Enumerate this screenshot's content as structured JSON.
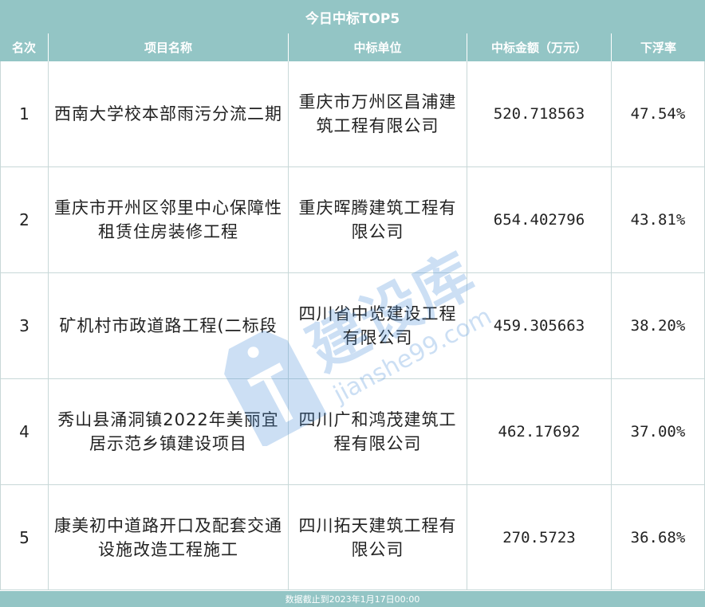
{
  "title": "今日中标TOP5",
  "headers": {
    "rank": "名次",
    "project": "项目名称",
    "winner": "中标单位",
    "amount": "中标金额（万元）",
    "rate": "下浮率"
  },
  "rows": [
    {
      "rank": "1",
      "project": "西南大学校本部雨污分流二期",
      "winner": "重庆市万州区昌浦建筑工程有限公司",
      "amount": "520.718563",
      "rate": "47.54%"
    },
    {
      "rank": "2",
      "project": "重庆市开州区邻里中心保障性租赁住房装修工程",
      "winner": "重庆晖腾建筑工程有限公司",
      "amount": "654.402796",
      "rate": "43.81%"
    },
    {
      "rank": "3",
      "project": "矿机村市政道路工程(二标段",
      "winner": "四川省中览建设工程有限公司",
      "amount": "459.305663",
      "rate": "38.20%"
    },
    {
      "rank": "4",
      "project": "秀山县涌洞镇2022年美丽宜居示范乡镇建设项目",
      "winner": "四川广和鸿茂建筑工程有限公司",
      "amount": "462.17692",
      "rate": "37.00%"
    },
    {
      "rank": "5",
      "project": "康美初中道路开口及配套交通设施改造工程施工",
      "winner": "四川拓天建筑工程有限公司",
      "amount": "270.5723",
      "rate": "36.68%"
    }
  ],
  "footer": "数据截止到2023年1月17日00:00",
  "watermark": {
    "brand": "建设库",
    "domain": "jianshe99.com"
  },
  "colors": {
    "header_bg": "#93c5c5",
    "header_text": "#ffffff",
    "grid": "#c8d8d8",
    "watermark": "#4a90d9"
  }
}
